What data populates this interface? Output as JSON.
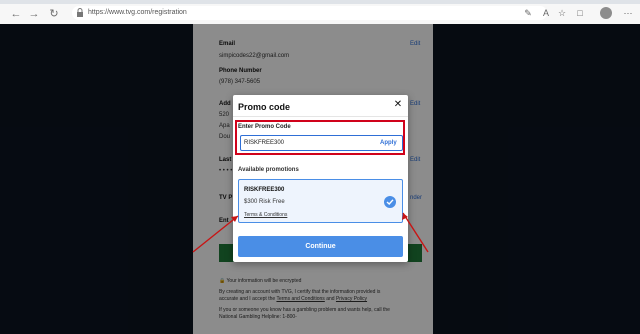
{
  "browser": {
    "url": "https://www.tvg.com/registration",
    "icons": [
      "back-icon",
      "forward-icon",
      "refresh-icon",
      "lock-icon",
      "favorites-icon",
      "read-aloud-icon",
      "extensions-icon",
      "collections-icon",
      "profile-icon"
    ]
  },
  "background_form": {
    "email_label": "Email",
    "email_value": "simpicodes22@gmail.com",
    "edit": "Edit",
    "phone_label": "Phone Number",
    "phone_value": "(978) 347-5605",
    "address_fragment": "Add",
    "address_line_a": "520",
    "address_line_b": "Apa",
    "address_line_c": "Dou",
    "last_fragment": "Last",
    "dots": "• • • •",
    "tv_fragment": "TV P",
    "tv_edit": "nder",
    "ent_fragment": "Ent",
    "encrypted": "Your information will be encrypted",
    "consent_1": "By creating an account with TVG, I certify that the information provided is",
    "consent_2_pre": "accurate and I accept the ",
    "terms": "Terms and Conditions",
    "and": " and ",
    "privacy": "Privacy Policy",
    "help_1": "If you or someone you know has a gambling problem and wants help, call the",
    "help_2": "National Gambling Helpline: 1-800-"
  },
  "modal": {
    "title": "Promo code",
    "close_icon": "close-icon",
    "promo_label": "Enter Promo Code",
    "promo_value": "RISKFREE300",
    "apply": "Apply",
    "available_title": "Available promotions",
    "promotions": [
      {
        "code": "RISKFREE300",
        "description": "$300 Risk Free",
        "terms": "Terms & Conditions",
        "selected": true
      }
    ],
    "continue": "Continue"
  },
  "colors": {
    "accent": "#4a8ee6",
    "highlight": "#d0021b",
    "backdrop": "#0b1420"
  }
}
